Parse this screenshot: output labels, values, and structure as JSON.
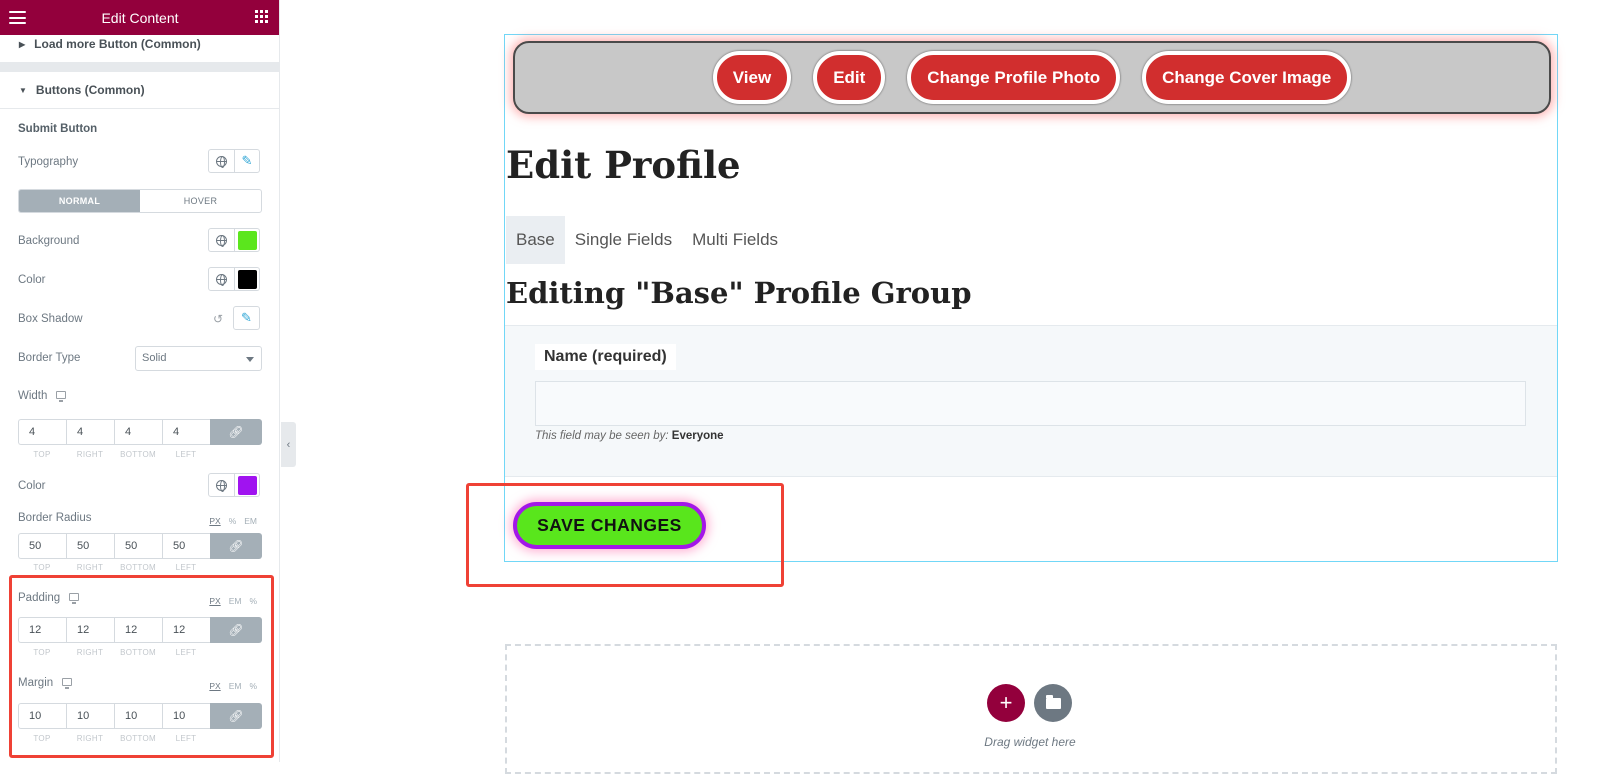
{
  "panel": {
    "title": "Edit Content",
    "sections": {
      "load_more": "Load more Button (Common)",
      "buttons": "Buttons (Common)"
    },
    "subsection": "Submit Button",
    "typography_label": "Typography",
    "state_tabs": [
      "NORMAL",
      "HOVER"
    ],
    "active_state": "NORMAL",
    "background_label": "Background",
    "background_color": "#5be61d",
    "color_label": "Color",
    "text_color": "#000000",
    "box_shadow_label": "Box Shadow",
    "border_type_label": "Border Type",
    "border_type_value": "Solid",
    "width_label": "Width",
    "width_values": [
      "4",
      "4",
      "4",
      "4"
    ],
    "border_color_label": "Color",
    "border_color": "#a013f0",
    "border_radius_label": "Border Radius",
    "border_radius_values": [
      "50",
      "50",
      "50",
      "50"
    ],
    "padding_label": "Padding",
    "padding_values": [
      "12",
      "12",
      "12",
      "12"
    ],
    "margin_label": "Margin",
    "margin_values": [
      "10",
      "10",
      "10",
      "10"
    ],
    "dim_labels": [
      "TOP",
      "RIGHT",
      "BOTTOM",
      "LEFT"
    ],
    "units": {
      "radius": [
        "PX",
        "%",
        "EM"
      ],
      "padding": [
        "PX",
        "EM",
        "%"
      ],
      "margin": [
        "PX",
        "EM",
        "%"
      ]
    }
  },
  "preview": {
    "nav_buttons": [
      "View",
      "Edit",
      "Change Profile Photo",
      "Change Cover Image"
    ],
    "page_title": "Edit Profile",
    "tabs": [
      "Base",
      "Single Fields",
      "Multi Fields"
    ],
    "active_tab": "Base",
    "group_title": "Editing \"Base\" Profile Group",
    "field_label": "Name (required)",
    "visibility_prefix": "This field may be seen by:",
    "visibility_value": "Everyone",
    "save_label": "SAVE CHANGES",
    "drag_text": "Drag widget here"
  }
}
